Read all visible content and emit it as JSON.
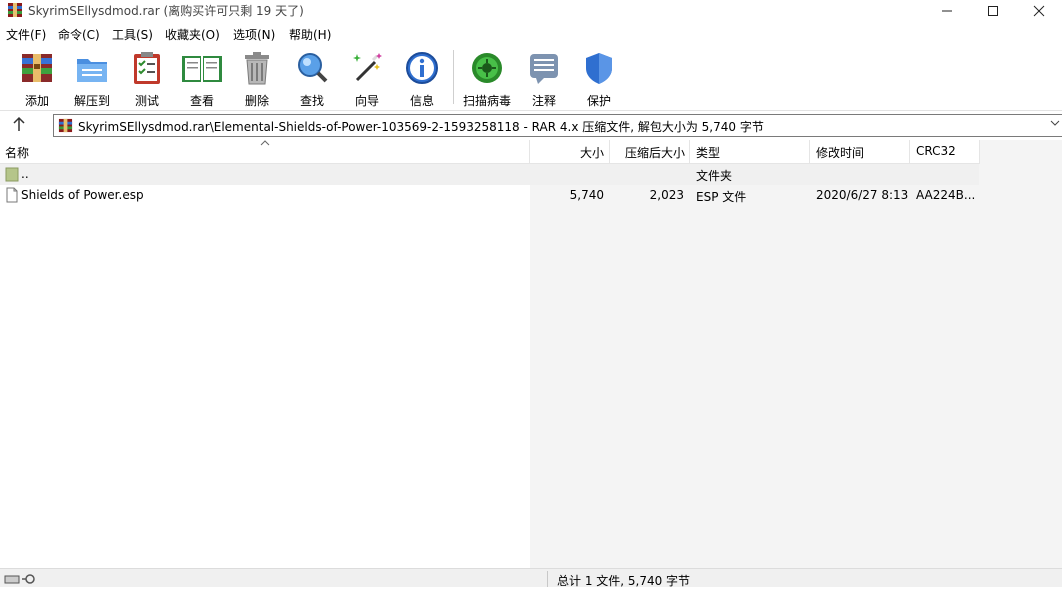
{
  "window": {
    "title": "SkyrimSEllysdmod.rar (离购买许可只剩 19 天了)"
  },
  "menu": [
    "文件(F)",
    "命令(C)",
    "工具(S)",
    "收藏夹(O)",
    "选项(N)",
    "帮助(H)"
  ],
  "toolbar": {
    "add": "添加",
    "extract": "解压到",
    "test": "测试",
    "view": "查看",
    "delete": "删除",
    "find": "查找",
    "wizard": "向导",
    "info": "信息",
    "scan": "扫描病毒",
    "comment": "注释",
    "protect": "保护"
  },
  "address": {
    "path": "SkyrimSEllysdmod.rar\\Elemental-Shields-of-Power-103569-2-1593258118 - RAR 4.x 压缩文件, 解包大小为 5,740 字节"
  },
  "columns": {
    "name": "名称",
    "size": "大小",
    "packed": "压缩后大小",
    "type": "类型",
    "modified": "修改时间",
    "crc": "CRC32"
  },
  "rows": [
    {
      "name": "..",
      "size": "",
      "packed": "",
      "type": "文件夹",
      "modified": "",
      "crc": ""
    },
    {
      "name": "Shields of Power.esp",
      "size": "5,740",
      "packed": "2,023",
      "type": "ESP 文件",
      "modified": "2020/6/27 8:13",
      "crc": "AA224B..."
    }
  ],
  "status": {
    "summary": "总计 1 文件, 5,740 字节"
  }
}
